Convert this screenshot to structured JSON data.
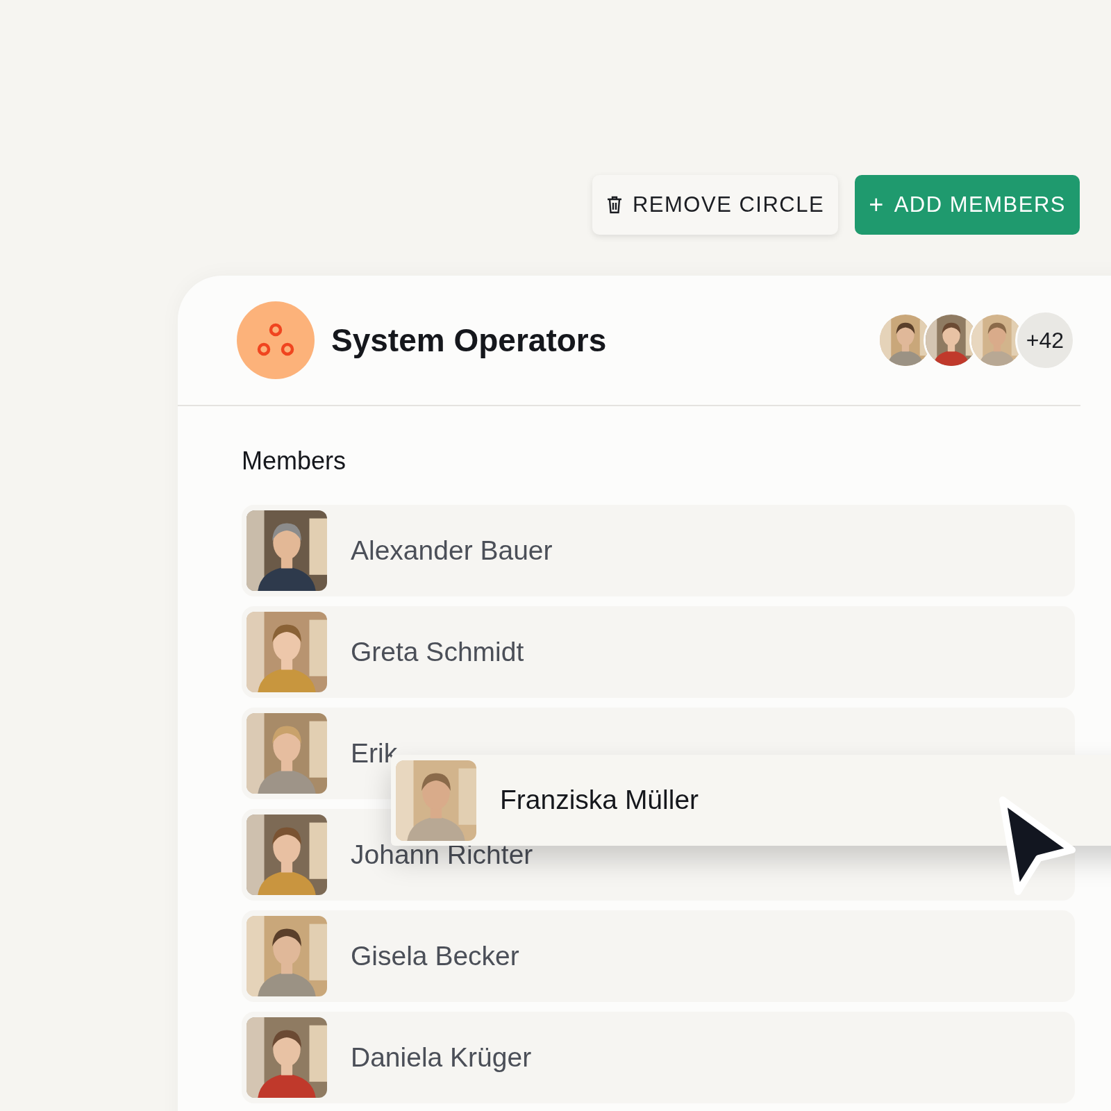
{
  "toolbar": {
    "buttons": [
      {
        "kind": "remove",
        "label": "REMOVE CIRCLE"
      },
      {
        "kind": "add",
        "icon": "+",
        "label": "ADD MEMBERS"
      }
    ]
  },
  "circle": {
    "title": "System Operators",
    "more_count": "+42"
  },
  "members": {
    "heading": "Members",
    "rows": [
      {
        "name": "Alexander Bauer"
      },
      {
        "name": "Greta Schmidt"
      },
      {
        "name": "Erik"
      },
      {
        "name": "Johann Richter"
      },
      {
        "name": "Gisela Becker"
      },
      {
        "name": "Daniela Krüger"
      }
    ]
  },
  "dragged_member": {
    "name": "Franziska Müller"
  }
}
